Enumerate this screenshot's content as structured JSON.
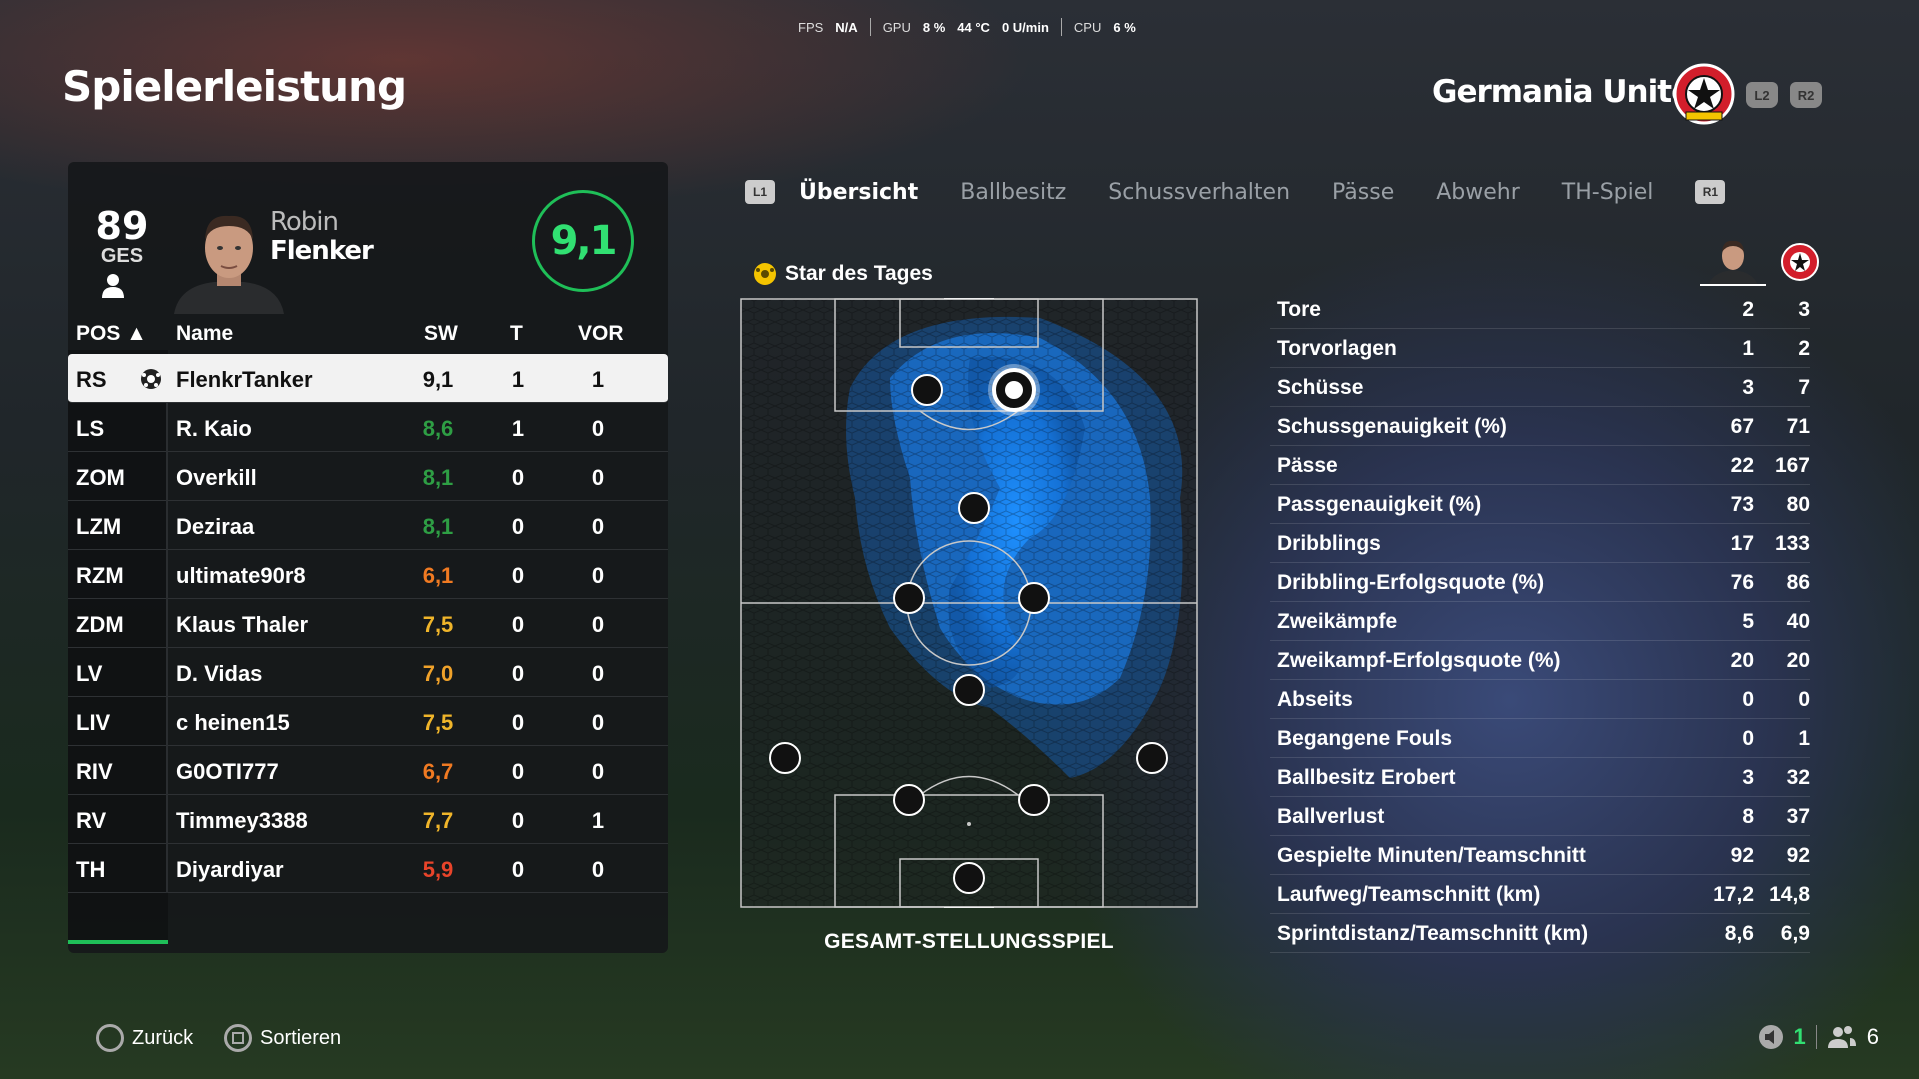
{
  "perf": {
    "fps_label": "FPS",
    "fps_value": "N/A",
    "gpu_label": "GPU",
    "gpu_usage": "8 %",
    "gpu_temp": "44 °C",
    "gpu_rpm": "0 U/min",
    "cpu_label": "CPU",
    "cpu_usage": "6 %"
  },
  "page_title": "Spielerleistung",
  "team": {
    "name": "Germania United",
    "l2": "L2",
    "r2": "R2"
  },
  "player": {
    "overall": "89",
    "overall_label": "GES",
    "first_name": "Robin",
    "last_name": "Flenker",
    "rating": "9,1"
  },
  "table": {
    "headers": {
      "pos": "POS ▲",
      "name": "Name",
      "sw": "SW",
      "t": "T",
      "vor": "VOR"
    },
    "rows": [
      {
        "pos": "RS",
        "name": "FlenkrTanker",
        "sw": "9,1",
        "t": "1",
        "vor": "1",
        "color": "#111111"
      },
      {
        "pos": "LS",
        "name": "R. Kaio",
        "sw": "8,6",
        "t": "1",
        "vor": "0",
        "color": "#2e9e44"
      },
      {
        "pos": "ZOM",
        "name": "Overkill",
        "sw": "8,1",
        "t": "0",
        "vor": "0",
        "color": "#2e9e44"
      },
      {
        "pos": "LZM",
        "name": "Deziraa",
        "sw": "8,1",
        "t": "0",
        "vor": "0",
        "color": "#2e9e44"
      },
      {
        "pos": "RZM",
        "name": "ultimate90r8",
        "sw": "6,1",
        "t": "0",
        "vor": "0",
        "color": "#f07a22"
      },
      {
        "pos": "ZDM",
        "name": "Klaus Thaler",
        "sw": "7,5",
        "t": "0",
        "vor": "0",
        "color": "#f0b52a"
      },
      {
        "pos": "LV",
        "name": "D. Vidas",
        "sw": "7,0",
        "t": "0",
        "vor": "0",
        "color": "#f0a22a"
      },
      {
        "pos": "LIV",
        "name": "c heinen15",
        "sw": "7,5",
        "t": "0",
        "vor": "0",
        "color": "#f0b52a"
      },
      {
        "pos": "RIV",
        "name": "G0OTI777",
        "sw": "6,7",
        "t": "0",
        "vor": "0",
        "color": "#f07a22"
      },
      {
        "pos": "RV",
        "name": "Timmey3388",
        "sw": "7,7",
        "t": "0",
        "vor": "1",
        "color": "#f0b52a"
      },
      {
        "pos": "TH",
        "name": "Diyardiyar",
        "sw": "5,9",
        "t": "0",
        "vor": "0",
        "color": "#e8442a"
      }
    ]
  },
  "tabs": {
    "l1": "L1",
    "r1": "R1",
    "items": [
      "Übersicht",
      "Ballbesitz",
      "Schussverhalten",
      "Pässe",
      "Abwehr",
      "TH-Spiel"
    ]
  },
  "star_label": "Star des Tages",
  "pitch_caption": "GESAMT-STELLUNGSSPIEL",
  "stats": [
    {
      "label": "Tore",
      "player": "2",
      "team": "3"
    },
    {
      "label": "Torvorlagen",
      "player": "1",
      "team": "2"
    },
    {
      "label": "Schüsse",
      "player": "3",
      "team": "7"
    },
    {
      "label": "Schussgenauigkeit (%)",
      "player": "67",
      "team": "71"
    },
    {
      "label": "Pässe",
      "player": "22",
      "team": "167"
    },
    {
      "label": "Passgenauigkeit (%)",
      "player": "73",
      "team": "80"
    },
    {
      "label": "Dribblings",
      "player": "17",
      "team": "133"
    },
    {
      "label": "Dribbling-Erfolgsquote (%)",
      "player": "76",
      "team": "86"
    },
    {
      "label": "Zweikämpfe",
      "player": "5",
      "team": "40"
    },
    {
      "label": "Zweikampf-Erfolgsquote (%)",
      "player": "20",
      "team": "20"
    },
    {
      "label": "Abseits",
      "player": "0",
      "team": "0"
    },
    {
      "label": "Begangene Fouls",
      "player": "0",
      "team": "1"
    },
    {
      "label": "Ballbesitz Erobert",
      "player": "3",
      "team": "32"
    },
    {
      "label": "Ballverlust",
      "player": "8",
      "team": "37"
    },
    {
      "label": "Gespielte Minuten/Teamschnitt",
      "player": "92",
      "team": "92"
    },
    {
      "label": "Laufweg/Teamschnitt (km)",
      "player": "17,2",
      "team": "14,8"
    },
    {
      "label": "Sprintdistanz/Teamschnitt (km)",
      "player": "8,6",
      "team": "6,9"
    }
  ],
  "footer": {
    "back": "Zurück",
    "sort": "Sortieren",
    "count_a": "1",
    "count_b": "6"
  }
}
